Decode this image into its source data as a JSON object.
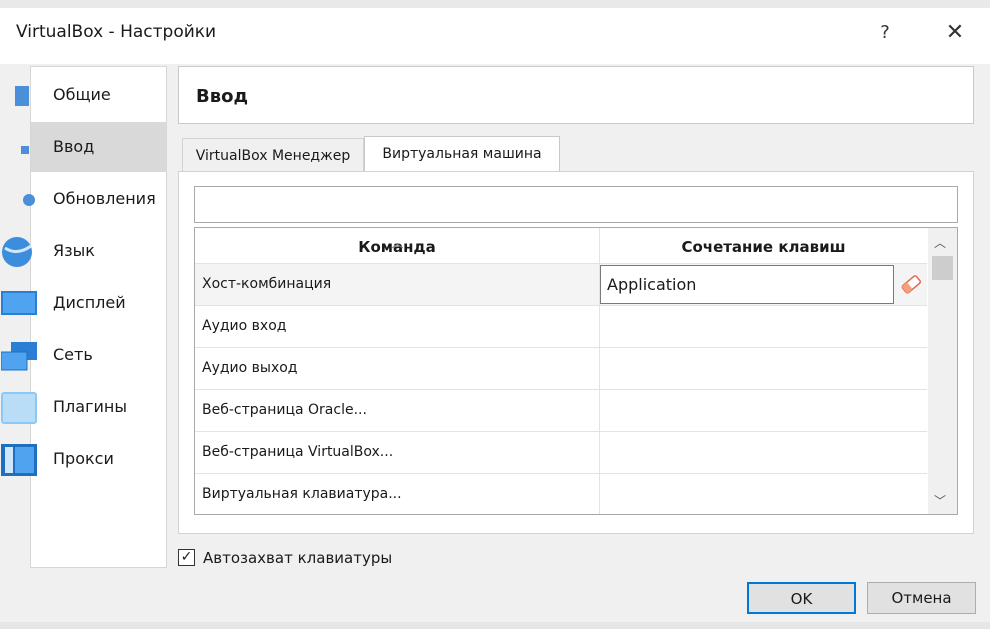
{
  "window": {
    "title": "VirtualBox - Настройки",
    "help": "?",
    "close": "✕"
  },
  "sidebar": {
    "items": [
      {
        "label": "Общие",
        "icon": "general-icon"
      },
      {
        "label": "Ввод",
        "icon": "input-icon",
        "selected": true
      },
      {
        "label": "Обновления",
        "icon": "update-icon"
      },
      {
        "label": "Язык",
        "icon": "globe-icon"
      },
      {
        "label": "Дисплей",
        "icon": "display-icon"
      },
      {
        "label": "Сеть",
        "icon": "network-icon"
      },
      {
        "label": "Плагины",
        "icon": "plugin-icon"
      },
      {
        "label": "Прокси",
        "icon": "proxy-icon"
      }
    ]
  },
  "header": {
    "title": "Ввод"
  },
  "tabs": [
    {
      "label": "VirtualBox Менеджер",
      "active": false
    },
    {
      "label": "Виртуальная машина",
      "active": true
    }
  ],
  "filter": {
    "value": ""
  },
  "table": {
    "columns": [
      "Команда",
      "Сочетание клавиш"
    ],
    "rows": [
      {
        "command": "Хост-комбинация",
        "shortcut": "Application"
      },
      {
        "command": "Аудио вход",
        "shortcut": ""
      },
      {
        "command": "Аудио выход",
        "shortcut": ""
      },
      {
        "command": "Веб-страница Oracle...",
        "shortcut": ""
      },
      {
        "command": "Веб-страница VirtualBox...",
        "shortcut": ""
      },
      {
        "command": "Виртуальная клавиатура...",
        "shortcut": ""
      }
    ]
  },
  "autocapture": {
    "label": "Автозахват клавиатуры",
    "checked": true
  },
  "buttons": {
    "ok": "OK",
    "cancel": "Отмена"
  },
  "colors": {
    "accent": "#0078d7",
    "selected_bg": "#d9d9d9"
  }
}
